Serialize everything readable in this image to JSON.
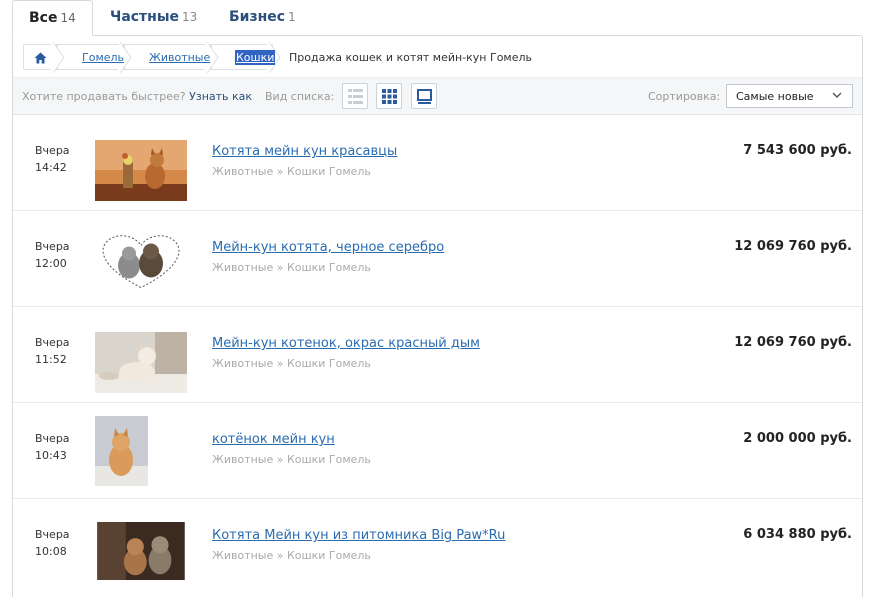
{
  "tabs": [
    {
      "label": "Все",
      "count": "14"
    },
    {
      "label": "Частные",
      "count": "13"
    },
    {
      "label": "Бизнес",
      "count": "1"
    }
  ],
  "breadcrumb": {
    "items": [
      "Гомель",
      "Животные",
      "Кошки"
    ],
    "current": "Продажа кошек и котят мейн-кун Гомель"
  },
  "toolbar": {
    "promo_text": "Хотите продавать быстрее?",
    "promo_link": "Узнать как",
    "view_label": "Вид списка:",
    "sort_label": "Сортировка:",
    "sort_value": "Самые новые"
  },
  "listings": [
    {
      "day": "Вчера",
      "time": "14:42",
      "title": "Котята мейн кун красавцы",
      "category": "Животные » Кошки Гомель",
      "price": "7 543 600 руб."
    },
    {
      "day": "Вчера",
      "time": "12:00",
      "title": "Мейн-кун котята, черное серебро",
      "category": "Животные » Кошки Гомель",
      "price": "12 069 760 руб."
    },
    {
      "day": "Вчера",
      "time": "11:52",
      "title": "Мейн-кун котенок, окрас красный дым",
      "category": "Животные » Кошки Гомель",
      "price": "12 069 760 руб."
    },
    {
      "day": "Вчера",
      "time": "10:43",
      "title": "котёнок мейн кун",
      "category": "Животные » Кошки Гомель",
      "price": "2 000 000 руб."
    },
    {
      "day": "Вчера",
      "time": "10:08",
      "title": "Котята Мейн кун из питомника Big Paw*Ru",
      "category": "Животные » Кошки Гомель",
      "price": "6 034 880 руб."
    }
  ],
  "colors": {
    "link": "#2a6cb0",
    "tab": "#2a4f7d",
    "selection": "#2f64c1"
  }
}
